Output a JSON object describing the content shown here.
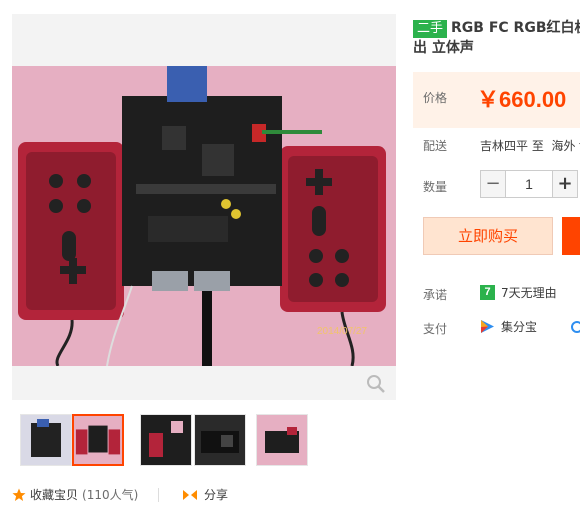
{
  "product": {
    "badge": "二手",
    "title": "RGB FC RGB红白机 出 立体声"
  },
  "price": {
    "label": "价格",
    "value": "￥660.00"
  },
  "shipping": {
    "label": "配送",
    "from": "吉林四平",
    "to_word": "至",
    "destination": "海外"
  },
  "quantity": {
    "label": "数量",
    "value": "1",
    "minus": "−",
    "plus": "+"
  },
  "buttons": {
    "buy_now": "立即购买"
  },
  "promise": {
    "label": "承诺",
    "badge": "7",
    "text": "7天无理由"
  },
  "payment": {
    "label": "支付",
    "method": "集分宝"
  },
  "actions": {
    "favorite": "收藏宝贝",
    "favorite_count": "(110人气)",
    "share": "分享"
  },
  "photo": {
    "date_stamp": "2014/07/27"
  },
  "colors": {
    "accent": "#ff4400",
    "price_bg": "#fff2e8",
    "badge_green": "#2bb24c"
  }
}
